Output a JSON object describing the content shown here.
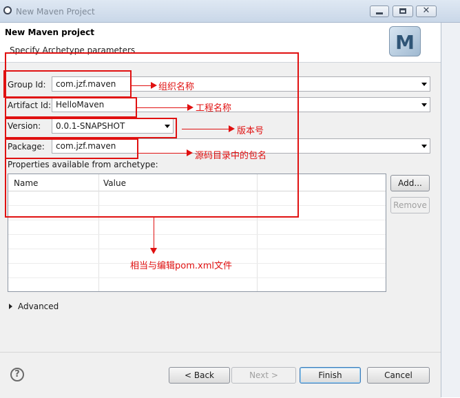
{
  "window": {
    "title": "New Maven Project"
  },
  "header": {
    "title": "New Maven project",
    "description": "Specify Archetype parameters",
    "logo_letter": "M"
  },
  "form": {
    "group_id": {
      "label": "Group Id:",
      "value": "com.jzf.maven"
    },
    "artifact_id": {
      "label": "Artifact Id:",
      "value": "HelloMaven"
    },
    "version": {
      "label": "Version:",
      "value": "0.0.1-SNAPSHOT"
    },
    "package": {
      "label": "Package:",
      "value": "com.jzf.maven"
    }
  },
  "properties": {
    "label": "Properties available from archetype:",
    "columns": [
      "Name",
      "Value"
    ],
    "add_label": "Add...",
    "remove_label": "Remove"
  },
  "advanced": {
    "label": "Advanced"
  },
  "annotations": {
    "group_id": "组织名称",
    "artifact_id": "工程名称",
    "version": "版本号",
    "package": "源码目录中的包名",
    "properties": "相当与编辑pom.xml文件"
  },
  "buttons": {
    "back": "< Back",
    "next": "Next >",
    "finish": "Finish",
    "cancel": "Cancel"
  },
  "colors": {
    "annotation": "#e01010",
    "default_button_border": "#3d7bb8"
  }
}
